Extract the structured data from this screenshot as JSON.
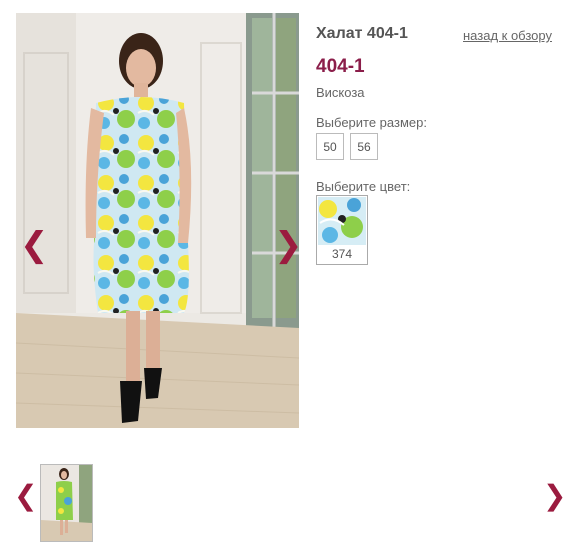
{
  "product": {
    "title": "Халат 404-1",
    "back_link": "назад к обзору",
    "article": "404-1",
    "material": "Вискоза"
  },
  "sizes": {
    "label": "Выберите размер:",
    "options": [
      "50",
      "56"
    ]
  },
  "colors": {
    "label": "Выберите цвет:",
    "options": [
      {
        "code": "374"
      }
    ]
  },
  "gallery": {
    "prev_icon": "chevron-left-icon",
    "next_icon": "chevron-right-icon",
    "prev_glyph": "❮",
    "next_glyph": "❯",
    "arrow_color": "#9b1b3f"
  },
  "thumbnails": {
    "prev_glyph": "❮",
    "next_glyph": "❯",
    "count": 1
  }
}
